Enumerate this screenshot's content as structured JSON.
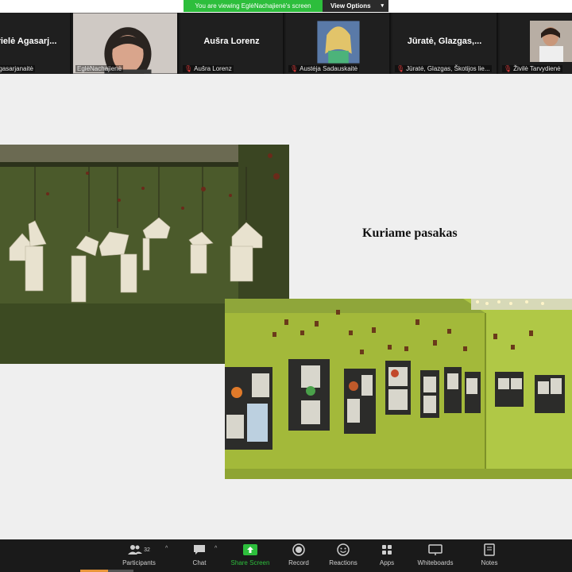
{
  "banner": {
    "viewing_text": "You are viewing EglėNachajienė's screen",
    "view_options_label": "View Options"
  },
  "participants": [
    {
      "big_name": "rielė  Agasarj...",
      "label": "lė Agasarjanaitė",
      "muted": false
    },
    {
      "big_name": "",
      "label": "EglėNachajienė",
      "muted": false
    },
    {
      "big_name": "Aušra Lorenz",
      "label": "Aušra Lorenz",
      "muted": true
    },
    {
      "big_name": "",
      "label": "Austėja Sadauskaitė",
      "muted": true
    },
    {
      "big_name": "Jūratė,  Glazgas,...",
      "label": "Jūratė, Glazgas, Škotijos lie...",
      "muted": true
    },
    {
      "big_name": "",
      "label": "Živilė Tarvydienė",
      "muted": true
    }
  ],
  "slide": {
    "title": "Kuriame pasakas"
  },
  "toolbar": {
    "participants_label": "Participants",
    "participants_count": "32",
    "chat_label": "Chat",
    "share_label": "Share Screen",
    "record_label": "Record",
    "reactions_label": "Reactions",
    "apps_label": "Apps",
    "whiteboards_label": "Whiteboards",
    "notes_label": "Notes"
  },
  "colors": {
    "share_green": "#2dbe3c",
    "banner_green": "#2dbe3c",
    "wall_green": "#a9c23a",
    "dark_wall": "#4a5a2a"
  }
}
